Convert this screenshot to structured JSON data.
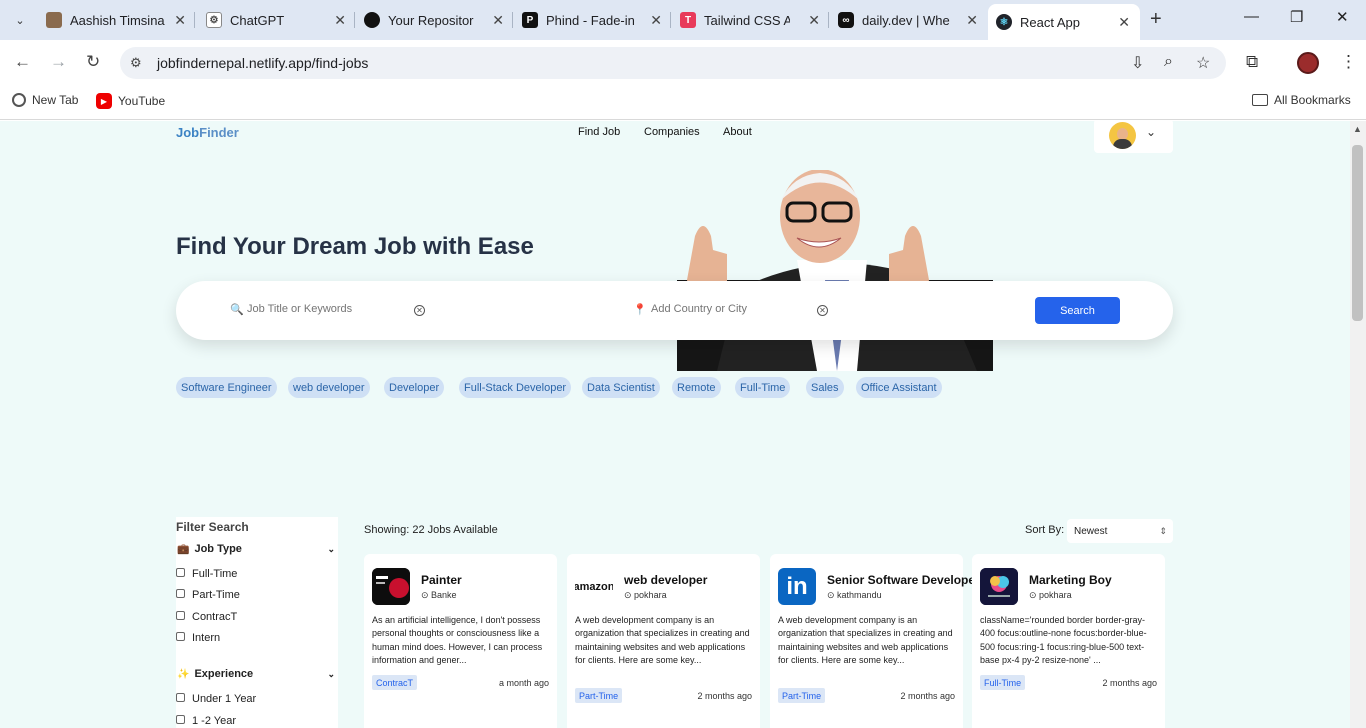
{
  "browser": {
    "tabs": [
      {
        "title": "Aashish Timsina",
        "icon": "avatar-icon"
      },
      {
        "title": "ChatGPT",
        "icon": "chatgpt-icon"
      },
      {
        "title": "Your Repositories",
        "icon": "github-icon"
      },
      {
        "title": "Phind - Fade-in a",
        "icon": "phind-icon"
      },
      {
        "title": "Tailwind CSS Abo",
        "icon": "tailwind-icon"
      },
      {
        "title": "daily.dev | Where",
        "icon": "dailydev-icon"
      },
      {
        "title": "React App",
        "icon": "react-icon"
      }
    ],
    "url": "jobfindernepal.netlify.app/find-jobs",
    "bookmarks": [
      {
        "label": "New Tab"
      },
      {
        "label": "YouTube"
      }
    ],
    "all_bookmarks": "All Bookmarks"
  },
  "site": {
    "logo_part1": "Job",
    "logo_part2": "Finder",
    "nav": [
      "Find Job",
      "Companies",
      "About"
    ]
  },
  "hero": {
    "title": "Find Your Dream Job with Ease",
    "search_job_placeholder": "Job Title or Keywords",
    "search_location_placeholder": "Add Country or City",
    "search_button": "Search"
  },
  "chips": [
    "Software Engineer",
    "web developer",
    "Developer",
    "Full-Stack Developer",
    "Data Scientist",
    "Remote",
    "Full-Time",
    "Sales",
    "Office Assistant"
  ],
  "filters": {
    "title": "Filter Search",
    "job_type_label": "Job Type",
    "job_types": [
      "Full-Time",
      "Part-Time",
      "ContracT",
      "Intern"
    ],
    "experience_label": "Experience",
    "experience": [
      "Under 1 Year",
      "1 -2 Year"
    ]
  },
  "results": {
    "showing_label": "Showing:",
    "showing_value": "22 Jobs Available",
    "sort_label": "Sort By:",
    "sort_value": "Newest"
  },
  "jobs": [
    {
      "title": "Painter",
      "location": "Banke",
      "description": "As an artificial intelligence, I don't possess personal thoughts or consciousness like a human mind does. However, I can process information and gener...",
      "type": "ContracT",
      "posted": "a month ago"
    },
    {
      "title": "web developer",
      "location": "pokhara",
      "description": "A web development company is an organization that specializes in creating and maintaining websites and web applications for clients. Here are some key...",
      "type": "Part-Time",
      "posted": "2 months ago"
    },
    {
      "title": "Senior Software Developer",
      "location": "kathmandu",
      "description": "A web development company is an organization that specializes in creating and maintaining websites and web applications for clients. Here are some key...",
      "type": "Part-Time",
      "posted": "2 months ago"
    },
    {
      "title": "Marketing Boy",
      "location": "pokhara",
      "description": "className='rounded border border-gray-400 focus:outline-none focus:border-blue-500 focus:ring-1 focus:ring-blue-500 text-base px-4 py-2 resize-none' ...",
      "type": "Full-Time",
      "posted": "2 months ago"
    }
  ],
  "company_logos": [
    "painter-logo",
    "amazon",
    "in",
    "learningcraft-logo"
  ],
  "colors": {
    "accent": "#2563eb",
    "page_bg": "#eefaf9",
    "chip_bg": "#cfe0f5"
  }
}
